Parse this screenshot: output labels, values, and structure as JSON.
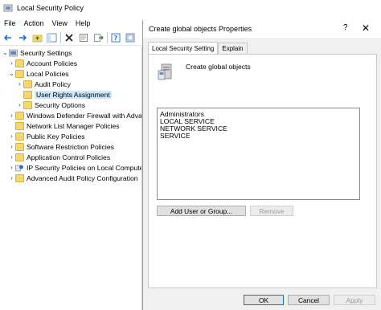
{
  "app": {
    "title": "Local Security Policy",
    "menu": [
      "File",
      "Action",
      "View",
      "Help"
    ]
  },
  "toolbar": {
    "buttons": [
      "back-icon",
      "forward-icon",
      "up-folder-icon",
      "show-tree-icon",
      "delete-icon",
      "properties-icon",
      "export-icon",
      "help-icon",
      "console-icon"
    ]
  },
  "tree": {
    "items": [
      {
        "label": "Security Settings",
        "expander": "⌄",
        "icon": "security-settings-icon"
      },
      {
        "label": "Account Policies",
        "expander": "›",
        "icon": "folder-icon"
      },
      {
        "label": "Local Policies",
        "expander": "⌄",
        "icon": "folder-icon"
      },
      {
        "label": "Audit Policy",
        "expander": "›",
        "icon": "folder-icon"
      },
      {
        "label": "User Rights Assignment",
        "expander": "",
        "icon": "folder-icon",
        "selected": true
      },
      {
        "label": "Security Options",
        "expander": "›",
        "icon": "folder-icon"
      },
      {
        "label": "Windows Defender Firewall with Adva",
        "expander": "›",
        "icon": "folder-icon"
      },
      {
        "label": "Network List Manager Policies",
        "expander": "",
        "icon": "folder-icon"
      },
      {
        "label": "Public Key Policies",
        "expander": "›",
        "icon": "folder-icon"
      },
      {
        "label": "Software Restriction Policies",
        "expander": "›",
        "icon": "folder-icon"
      },
      {
        "label": "Application Control Policies",
        "expander": "›",
        "icon": "folder-icon"
      },
      {
        "label": "IP Security Policies on Local Compute",
        "expander": "›",
        "icon": "ip-security-icon"
      },
      {
        "label": "Advanced Audit Policy Configuration",
        "expander": "›",
        "icon": "folder-icon"
      }
    ]
  },
  "dialog": {
    "title": "Create global objects Properties",
    "help_glyph": "?",
    "close_glyph": "✕",
    "tabs": [
      "Local Security Setting",
      "Explain"
    ],
    "policy_name": "Create global objects",
    "accounts": [
      "Administrators",
      "LOCAL SERVICE",
      "NETWORK SERVICE",
      "SERVICE"
    ],
    "add_button": "Add User or Group...",
    "remove_button": "Remove",
    "ok_button": "OK",
    "cancel_button": "Cancel",
    "apply_button": "Apply"
  }
}
